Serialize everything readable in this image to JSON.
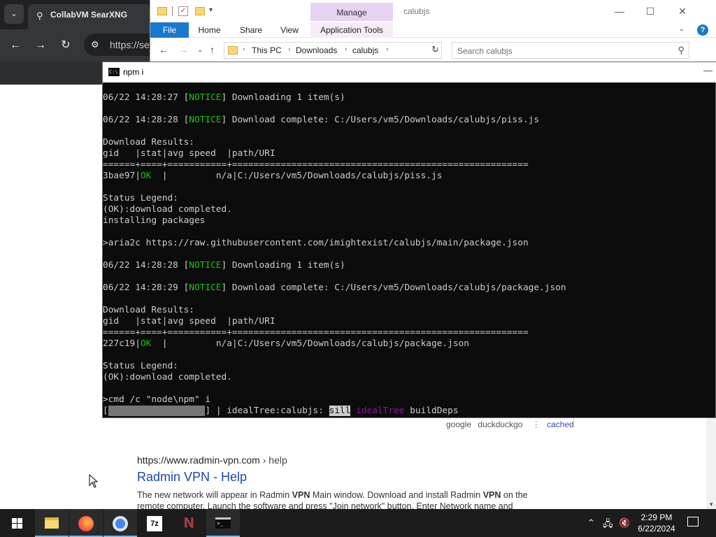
{
  "browser": {
    "tab_title": "CollabVM SearXNG",
    "omnibox_text": "https://se",
    "results": {
      "engines": [
        "google",
        "duckduckgo"
      ],
      "cached_label": "cached",
      "result_url": "https://www.radmin-vpn.com",
      "result_url_path": "› help",
      "result_title_a": "Radmin VPN",
      "result_title_sep": " - ",
      "result_title_b": "Help",
      "snippet_1": "The new network will appear in Radmin ",
      "snippet_2": "VPN",
      "snippet_3": " Main window. Download and install Radmin ",
      "snippet_4": "VPN",
      "snippet_5": " on the remote computer. Launch the software and press \"Join network\" button. Enter Network name and"
    }
  },
  "explorer": {
    "manage_label": "Manage",
    "title": "calubjs",
    "ribbon_tabs": [
      "File",
      "Home",
      "Share",
      "View",
      "Application Tools"
    ],
    "breadcrumb": [
      "This PC",
      "Downloads",
      "calubjs"
    ],
    "search_placeholder": "Search calubjs"
  },
  "console": {
    "title": "npm i",
    "lines": [
      {
        "pre": "06/22 14:28:27 [",
        "notice": "NOTICE",
        "post": "] Downloading 1 item(s)"
      },
      {
        "text": ""
      },
      {
        "pre": "06/22 14:28:28 [",
        "notice": "NOTICE",
        "post": "] Download complete: C:/Users/vm5/Downloads/calubjs/piss.js"
      },
      {
        "text": ""
      },
      {
        "text": "Download Results:"
      },
      {
        "text": "gid   |stat|avg speed  |path/URI"
      },
      {
        "text": "======+====+===========+======================================================="
      },
      {
        "gid": "3bae97",
        "ok": "OK",
        "rest": "  |         n/a|C:/Users/vm5/Downloads/calubjs/piss.js"
      },
      {
        "text": ""
      },
      {
        "text": "Status Legend:"
      },
      {
        "text": "(OK):download completed."
      },
      {
        "text": "installing packages"
      },
      {
        "text": ""
      },
      {
        "text": ">aria2c https://raw.githubusercontent.com/imightexist/calubjs/main/package.json"
      },
      {
        "text": ""
      },
      {
        "pre": "06/22 14:28:28 [",
        "notice": "NOTICE",
        "post": "] Downloading 1 item(s)"
      },
      {
        "text": ""
      },
      {
        "pre": "06/22 14:28:29 [",
        "notice": "NOTICE",
        "post": "] Download complete: C:/Users/vm5/Downloads/calubjs/package.json"
      },
      {
        "text": ""
      },
      {
        "text": "Download Results:"
      },
      {
        "text": "gid   |stat|avg speed  |path/URI"
      },
      {
        "text": "======+====+===========+======================================================="
      },
      {
        "gid": "227c19",
        "ok": "OK",
        "rest": "  |         n/a|C:/Users/vm5/Downloads/calubjs/package.json"
      },
      {
        "text": ""
      },
      {
        "text": "Status Legend:"
      },
      {
        "text": "(OK):download completed."
      },
      {
        "text": ""
      },
      {
        "text": ">cmd /c \"node\\npm\" i"
      }
    ],
    "progress": {
      "open": "[",
      "close": "] | idealTree:calubjs: ",
      "sill": "sill",
      "stage": "idealTree",
      "tail": " buildDeps"
    }
  },
  "taskbar": {
    "apps": [
      "file-explorer",
      "firefox",
      "chrome",
      "7-zip",
      "notepad-plus",
      "command-prompt"
    ],
    "time": "2:29 PM",
    "date": "6/22/2024"
  },
  "colors": {
    "console_bg": "#0c0c0c",
    "console_text": "#cccccc",
    "console_green": "#16c60c",
    "manage_tab": "#e7d2f0",
    "file_tab": "#1979ca",
    "link_blue": "#1a46b8"
  }
}
